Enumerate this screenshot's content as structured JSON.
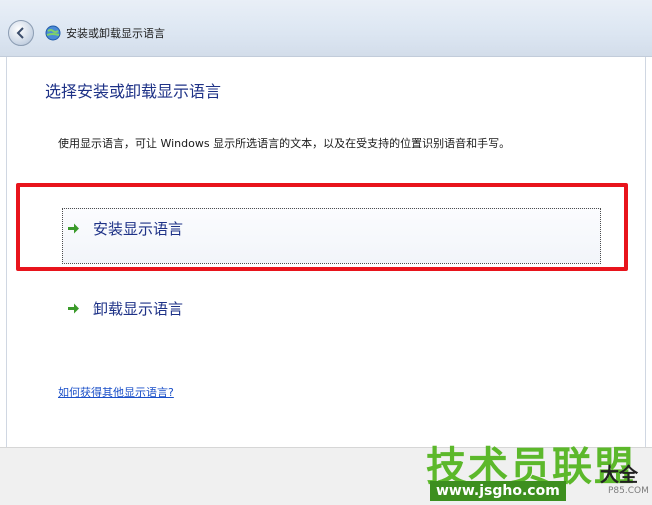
{
  "window": {
    "title": "安装或卸载显示语言"
  },
  "page": {
    "heading": "选择安装或卸载显示语言",
    "description": "使用显示语言，可让 Windows 显示所选语言的文本，以及在受支持的位置识别语音和手写。"
  },
  "options": [
    {
      "label": "安装显示语言",
      "icon": "green-arrow-icon"
    },
    {
      "label": "卸载显示语言",
      "icon": "green-arrow-icon"
    }
  ],
  "help_link": "如何获得其他显示语言?",
  "watermark": {
    "main": "技术员联盟",
    "side": "大全",
    "url": "www.jsgho.com",
    "small": "P85.COM"
  },
  "colors": {
    "highlight": "#e8141c",
    "heading": "#1e3287",
    "link": "#1a4fc8",
    "arrow": "#3a9a2a"
  }
}
